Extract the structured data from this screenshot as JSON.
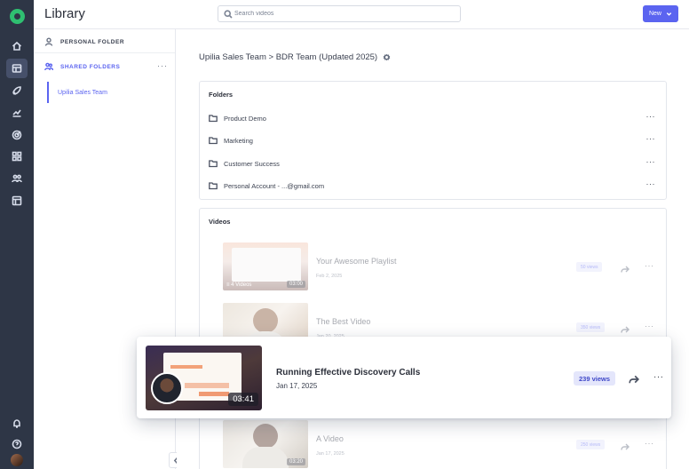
{
  "app": {
    "title": "Library"
  },
  "header": {
    "search_placeholder": "Search videos",
    "new_button": "New"
  },
  "folder_sidebar": {
    "personal": "PERSONAL FOLDER",
    "shared": "SHARED FOLDERS",
    "shared_more": "···",
    "team": "Upilia Sales Team"
  },
  "main": {
    "breadcrumb": "Upilia Sales Team > BDR Team (Updated 2025)",
    "folders_title": "Folders",
    "folders": [
      {
        "name": "Product Demo",
        "more": "···"
      },
      {
        "name": "Marketing",
        "more": "···"
      },
      {
        "name": "Customer Success",
        "more": "···"
      },
      {
        "name": "Personal Account - ...@gmail.com",
        "more": "···"
      }
    ],
    "videos_title": "Videos",
    "videos": [
      {
        "title": "Your Awesome Playlist",
        "date": "Feb 2, 2025",
        "views": "50 views",
        "duration": "03:00",
        "count": "≡ 4 Videos",
        "more": "···"
      },
      {
        "title": "The Best Video",
        "date": "Jan 20, 2025",
        "views": "350 views",
        "duration": "",
        "count": "",
        "more": "···"
      },
      {
        "title": "A Video",
        "date": "Jan 17, 2025",
        "views": "250 views",
        "duration": "03:20",
        "count": "",
        "more": "···"
      }
    ]
  },
  "highlight": {
    "title": "Running Effective Discovery Calls",
    "date": "Jan 17, 2025",
    "views": "239 views",
    "duration": "03:41",
    "more": "···"
  },
  "colors": {
    "rail": "#2e3646",
    "accent": "#5b64f0",
    "views_badge": "#e4e6fb"
  }
}
